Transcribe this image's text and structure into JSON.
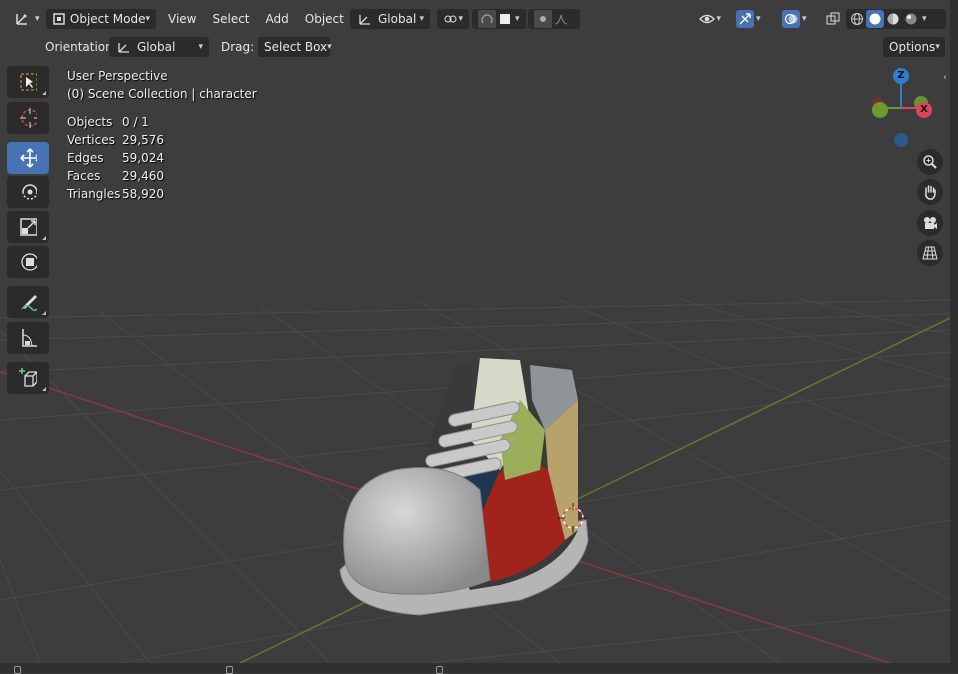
{
  "header": {
    "editor_type_icon": "axis-editor-icon",
    "mode": {
      "label": "Object Mode"
    },
    "menus": [
      "View",
      "Select",
      "Add",
      "Object"
    ],
    "transform_orientation": {
      "label": "Global"
    },
    "snap_icons": [
      "pivot-icon",
      "snap-icon",
      "proportional-edit-icon"
    ]
  },
  "tool_settings": {
    "orientation_label": "Orientation:",
    "orientation_value": "Global",
    "drag_label": "Drag:",
    "drag_value": "Select Box",
    "options_label": "Options"
  },
  "overlay": {
    "perspective": "User Perspective",
    "collection": "(0) Scene Collection | character",
    "stats": [
      {
        "key": "Objects",
        "value": "0 / 1"
      },
      {
        "key": "Vertices",
        "value": "29,576"
      },
      {
        "key": "Edges",
        "value": "59,024"
      },
      {
        "key": "Faces",
        "value": "29,460"
      },
      {
        "key": "Triangles",
        "value": "58,920"
      }
    ]
  },
  "toolbar": {
    "tools": [
      {
        "name": "select-box-tool",
        "icon": "select-box-icon",
        "active": false
      },
      {
        "name": "cursor-tool",
        "icon": "cursor-icon",
        "active": false
      },
      {
        "name": "move-tool",
        "icon": "move-icon",
        "active": true
      },
      {
        "name": "rotate-tool",
        "icon": "rotate-icon",
        "active": false
      },
      {
        "name": "scale-tool",
        "icon": "scale-icon",
        "active": false
      },
      {
        "name": "transform-tool",
        "icon": "transform-icon",
        "active": false
      },
      {
        "name": "annotate-tool",
        "icon": "annotate-icon",
        "active": false
      },
      {
        "name": "measure-tool",
        "icon": "measure-icon",
        "active": false
      },
      {
        "name": "add-cube-tool",
        "icon": "add-cube-icon",
        "active": false
      }
    ]
  },
  "gizmo": {
    "axes": [
      "Z",
      "X"
    ],
    "colors": {
      "x": "#e0445a",
      "y": "#6b9b2e",
      "z": "#2f7fd1"
    }
  },
  "nav_buttons": [
    "zoom-icon",
    "hand-pan-icon",
    "camera-icon",
    "grid-view-icon"
  ],
  "colors": {
    "active": "#4772b3",
    "background": "#3d3d3d",
    "widget": "#2b2b2b"
  }
}
